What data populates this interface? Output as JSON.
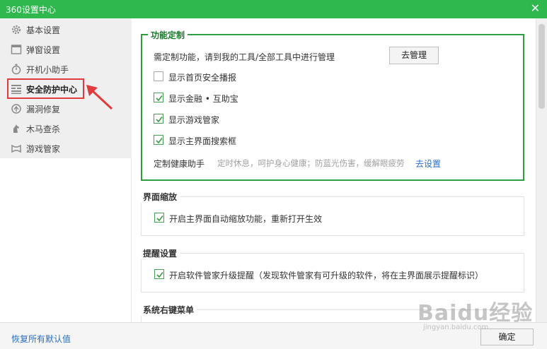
{
  "window": {
    "title": "360设置中心",
    "close_glyph": "✕"
  },
  "sidebar": {
    "items": [
      {
        "label": "基本设置",
        "icon": "gear-icon"
      },
      {
        "label": "弹窗设置",
        "icon": "window-icon"
      },
      {
        "label": "开机小助手",
        "icon": "stopwatch-icon"
      },
      {
        "label": "安全防护中心",
        "icon": "shield-grid-icon",
        "active": true
      },
      {
        "label": "漏洞修复",
        "icon": "patch-icon"
      },
      {
        "label": "木马查杀",
        "icon": "horse-icon"
      },
      {
        "label": "游戏管家",
        "icon": "gamepad-icon"
      }
    ]
  },
  "sections": {
    "custom": {
      "title": "功能定制",
      "desc": "需定制功能，请到我的工具/全部工具中进行管理",
      "manage_button": "去管理",
      "options": [
        {
          "label": "显示首页安全播报",
          "checked": false
        },
        {
          "label": "显示金融 • 互助宝",
          "checked": true
        },
        {
          "label": "显示游戏管家",
          "checked": true
        },
        {
          "label": "显示主界面搜索框",
          "checked": true
        }
      ],
      "health_label": "定制健康助手",
      "health_hint": "定时休息，呵护身心健康；防蓝光伤害，缓解眼疲劳",
      "health_link": "去设置"
    },
    "zoom": {
      "title": "界面缩放",
      "option": {
        "label": "开启主界面自动缩放功能，重新打开生效",
        "checked": true
      }
    },
    "remind": {
      "title": "提醒设置",
      "option": {
        "label": "开启软件管家升级提醒（发现软件管家有可升级的软件，将在主界面展示提醒标识）",
        "checked": true
      }
    },
    "context_menu": {
      "title": "系统右键菜单"
    }
  },
  "footer": {
    "reset_link": "恢复所有默认值",
    "ok_button": "确定"
  },
  "watermark": {
    "text": "Baidu经验",
    "sub": "jingyan.baidu.com"
  },
  "colors": {
    "title_bar": "#2eb84d",
    "highlight": "#e23b3b",
    "group_border": "#2e9e3e",
    "link": "#2a6ec6"
  }
}
